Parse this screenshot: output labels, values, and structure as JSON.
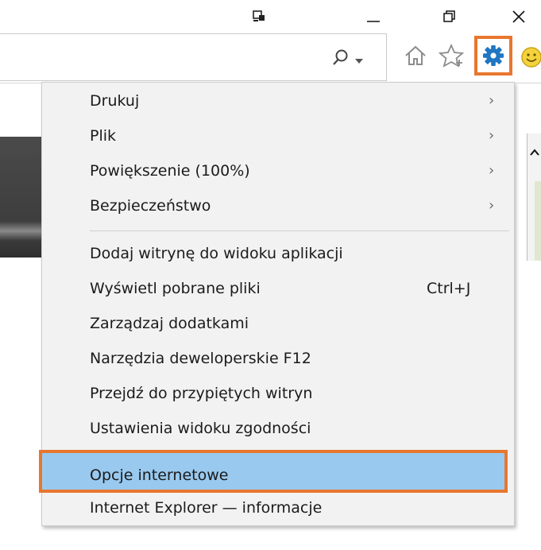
{
  "window": {
    "icons": {
      "snap": "snap-view-icon",
      "minimize": "minimize-icon",
      "restore": "restore-icon",
      "close": "close-icon"
    }
  },
  "toolbar": {
    "icons": {
      "search": "search-icon",
      "dropdown": "dropdown-arrow-icon",
      "home": "home-icon",
      "favorites": "favorites-star-icon",
      "tools": "gear-icon",
      "feedback": "smiley-icon"
    }
  },
  "menu": {
    "groups": [
      {
        "items": [
          {
            "label": "Drukuj",
            "submenu": true
          },
          {
            "label": "Plik",
            "submenu": true
          },
          {
            "label": "Powiększenie (100%)",
            "submenu": true
          },
          {
            "label": "Bezpieczeństwo",
            "submenu": true
          }
        ]
      },
      {
        "items": [
          {
            "label": "Dodaj witrynę do widoku aplikacji"
          },
          {
            "label": "Wyświetl pobrane pliki",
            "shortcut": "Ctrl+J"
          },
          {
            "label": "Zarządzaj dodatkami"
          },
          {
            "label": "Narzędzia deweloperskie F12"
          },
          {
            "label": "Przejdź do przypiętych witryn"
          },
          {
            "label": "Ustawienia widoku zgodności"
          },
          {
            "label": "Opcje internetowe",
            "highlighted": true
          },
          {
            "label": "Internet Explorer — informacje"
          }
        ]
      }
    ]
  },
  "colors": {
    "highlight_border": "#e8772e",
    "highlight_fill": "#99c9ef",
    "gear": "#1f76c2",
    "menu_bg": "#f2f2f2"
  }
}
